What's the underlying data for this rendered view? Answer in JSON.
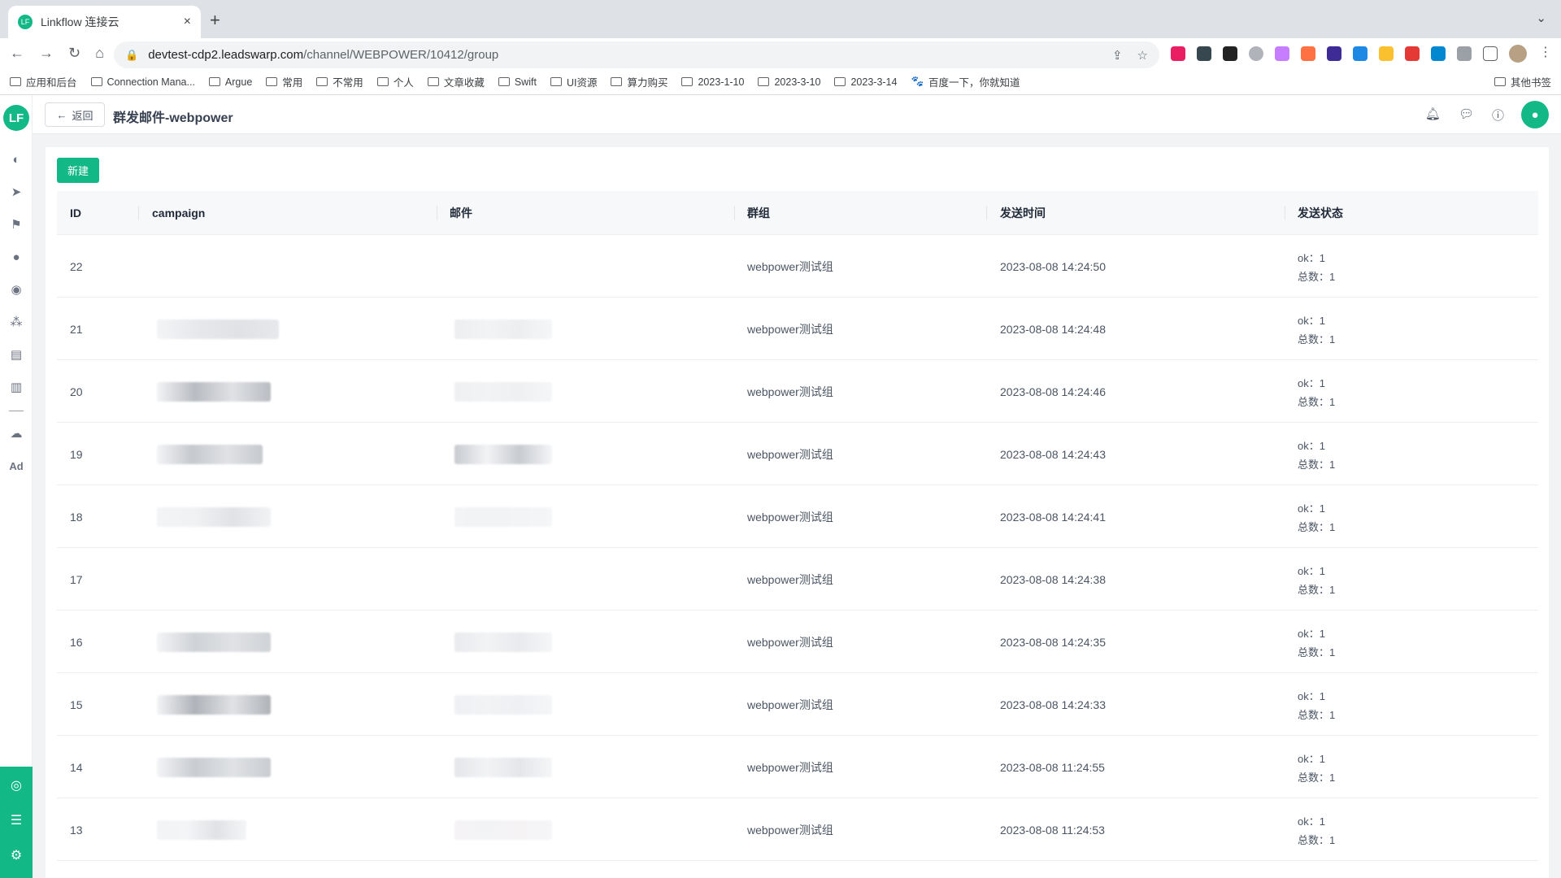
{
  "browser": {
    "tab_title": "Linkflow 连接云",
    "tab_close": "×",
    "new_tab": "+",
    "url_host": "devtest-cdp2.leadswarp.com",
    "url_path": "/channel/WEBPOWER/10412/group",
    "bookmarks": [
      "应用和后台",
      "Connection Mana...",
      "Argue",
      "常用",
      "不常用",
      "个人",
      "文章收藏",
      "Swift",
      "UI资源",
      "算力购买",
      "2023-1-10",
      "2023-3-10",
      "2023-3-14",
      "百度一下，你就知道"
    ],
    "other_bookmarks": "其他书签"
  },
  "app": {
    "logo": "LF",
    "back_label": "返回",
    "page_title": "群发邮件-webpower",
    "new_button": "新建",
    "sidebar_ad": "Ad",
    "accent": "#12b886"
  },
  "table": {
    "columns": [
      "ID",
      "campaign",
      "邮件",
      "群组",
      "发送时间",
      "发送状态"
    ],
    "ok_label": "ok：",
    "total_label": "总数：",
    "rows": [
      {
        "id": "22",
        "group": "webpower测试组",
        "time": "2023-08-08 14:24:50",
        "ok": "1",
        "total": "1"
      },
      {
        "id": "21",
        "group": "webpower测试组",
        "time": "2023-08-08 14:24:48",
        "ok": "1",
        "total": "1"
      },
      {
        "id": "20",
        "group": "webpower测试组",
        "time": "2023-08-08 14:24:46",
        "ok": "1",
        "total": "1"
      },
      {
        "id": "19",
        "group": "webpower测试组",
        "time": "2023-08-08 14:24:43",
        "ok": "1",
        "total": "1"
      },
      {
        "id": "18",
        "group": "webpower测试组",
        "time": "2023-08-08 14:24:41",
        "ok": "1",
        "total": "1"
      },
      {
        "id": "17",
        "group": "webpower测试组",
        "time": "2023-08-08 14:24:38",
        "ok": "1",
        "total": "1"
      },
      {
        "id": "16",
        "group": "webpower测试组",
        "time": "2023-08-08 14:24:35",
        "ok": "1",
        "total": "1"
      },
      {
        "id": "15",
        "group": "webpower测试组",
        "time": "2023-08-08 14:24:33",
        "ok": "1",
        "total": "1"
      },
      {
        "id": "14",
        "group": "webpower测试组",
        "time": "2023-08-08 11:24:55",
        "ok": "1",
        "total": "1"
      },
      {
        "id": "13",
        "group": "webpower测试组",
        "time": "2023-08-08 11:24:53",
        "ok": "1",
        "total": "1"
      }
    ]
  }
}
